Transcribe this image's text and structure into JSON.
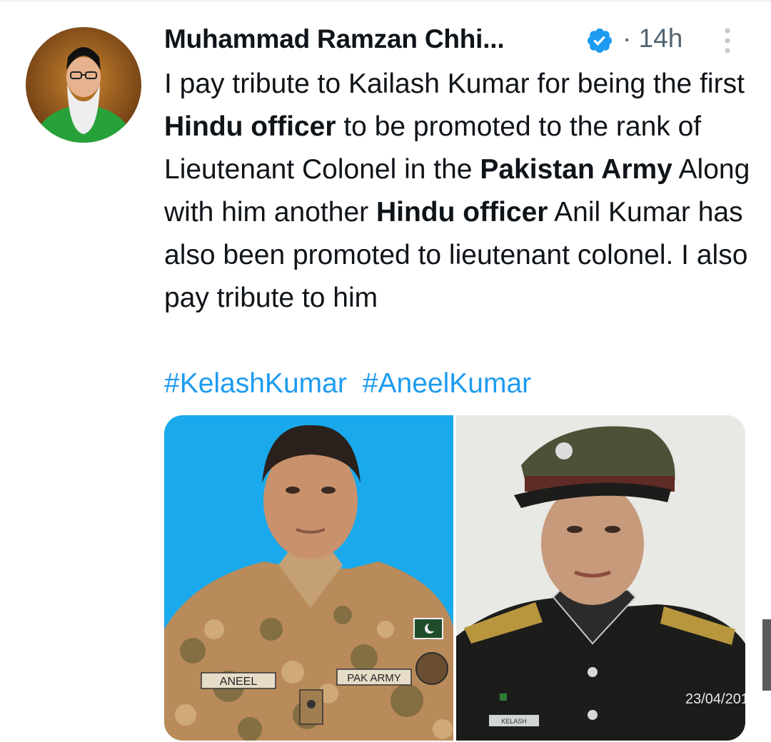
{
  "tweet": {
    "author_name": "Muhammad Ramzan Chhi...",
    "separator": "·",
    "time": "14h",
    "text_segments": [
      {
        "text": "I pay tribute to Kailash Kumar for being the first ",
        "bold": false
      },
      {
        "text": "Hindu officer",
        "bold": true
      },
      {
        "text": " to be promoted to the rank of Lieutenant Colonel in the ",
        "bold": false
      },
      {
        "text": "Pakistan Army",
        "bold": true
      },
      {
        "text": " Along with him another ",
        "bold": false
      },
      {
        "text": "Hindu officer",
        "bold": true
      },
      {
        "text": " Anil Kumar has also been promoted to lieutenant colonel. I also pay tribute to him",
        "bold": false
      }
    ],
    "hashtags": [
      "#KelashKumar",
      "#AneelKumar"
    ]
  },
  "media": {
    "left_photo": {
      "name_tape": "ANEEL",
      "army_tape": "PAK ARMY",
      "background": "#19a9ec"
    },
    "right_photo": {
      "name_tape": "KELASH",
      "date_stamp": "23/04/201",
      "background": "#e8e8e5"
    }
  },
  "colors": {
    "accent": "#1d9bf0",
    "text": "#0f1419",
    "secondary": "#536471"
  },
  "icons": {
    "verified": "verified-badge-icon",
    "more": "more-options-icon"
  }
}
